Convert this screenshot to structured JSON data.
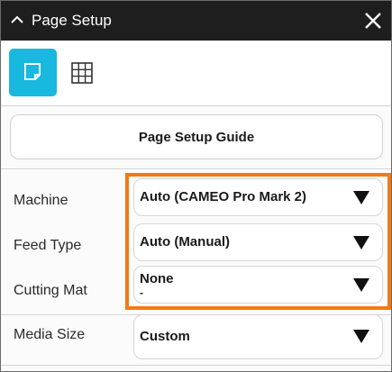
{
  "window": {
    "title": "Page Setup"
  },
  "tabs": [
    {
      "name": "page-setup-tab",
      "icon": "page-icon",
      "active": true
    },
    {
      "name": "grid-tab",
      "icon": "grid-icon",
      "active": false
    }
  ],
  "guide_button": {
    "label": "Page Setup Guide"
  },
  "settings": {
    "machine": {
      "label": "Machine",
      "value": "Auto (CAMEO Pro Mark 2)"
    },
    "feed_type": {
      "label": "Feed Type",
      "value": "Auto (Manual)"
    },
    "cutting_mat": {
      "label": "Cutting Mat",
      "value": "None",
      "sub": "-"
    },
    "media_size": {
      "label": "Media Size",
      "value": "Custom"
    }
  },
  "colors": {
    "titlebar": "#1e1e1e",
    "accent": "#19b8de",
    "highlight": "#f27a17"
  }
}
